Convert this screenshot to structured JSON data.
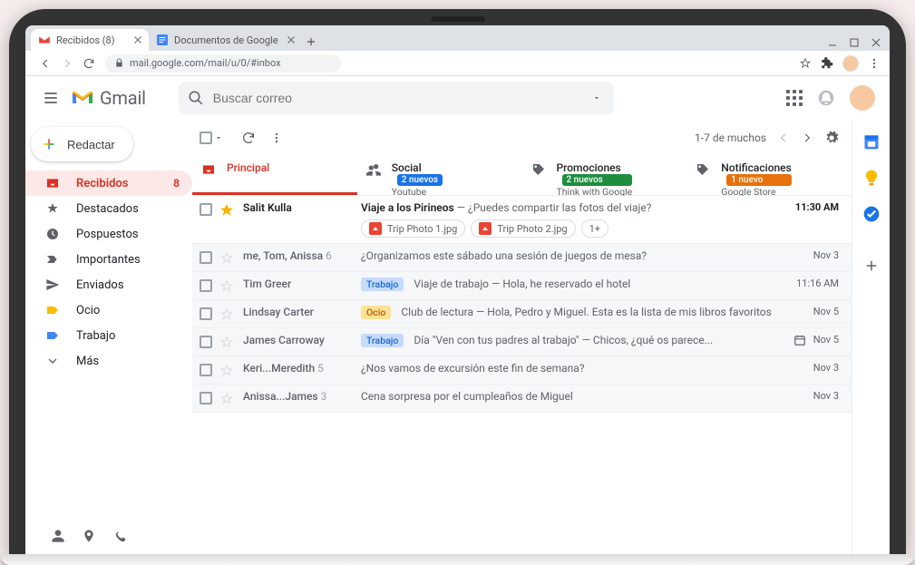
{
  "browser": {
    "tabs": [
      {
        "title": "Recibidos (8)",
        "active": true
      },
      {
        "title": "Documentos de Google",
        "active": false
      }
    ],
    "url": "mail.google.com/mail/u/0/#inbox"
  },
  "header": {
    "product": "Gmail",
    "search_placeholder": "Buscar correo"
  },
  "compose": "Redactar",
  "sidebar": {
    "items": [
      {
        "label": "Recibidos",
        "count": "8",
        "active": true,
        "icon": "inbox"
      },
      {
        "label": "Destacados",
        "icon": "star"
      },
      {
        "label": "Pospuestos",
        "icon": "clock"
      },
      {
        "label": "Importantes",
        "icon": "important"
      },
      {
        "label": "Enviados",
        "icon": "send"
      },
      {
        "label": "Ocio",
        "icon": "yellow"
      },
      {
        "label": "Trabajo",
        "icon": "blue"
      },
      {
        "label": "Más",
        "icon": "more"
      }
    ]
  },
  "toolbar": {
    "range": "1-7 de muchos"
  },
  "categories": [
    {
      "title": "Principal",
      "sub": "",
      "badge": "",
      "badge_cls": "",
      "active": true
    },
    {
      "title": "Social",
      "sub": "Youtube",
      "badge": "2 nuevos",
      "badge_cls": "blue"
    },
    {
      "title": "Promociones",
      "sub": "Think with Google",
      "badge": "2 nuevos",
      "badge_cls": "green"
    },
    {
      "title": "Notificaciones",
      "sub": "Google Store",
      "badge": "1 nuevo",
      "badge_cls": "orange"
    }
  ],
  "messages": [
    {
      "sender": "Salit Kulla",
      "subject": "Viaje a los Pirineos",
      "snippet": " — ¿Puedes compartir las fotos del viaje?",
      "date": "11:30 AM",
      "unread": true,
      "starred": true,
      "attachments": [
        "Trip Photo 1.jpg",
        "Trip Photo 2.jpg"
      ],
      "attachments_more": "1+"
    },
    {
      "sender": "me, Tom, Anissa",
      "sender_count": "6",
      "subject": "¿Organizamos este sábado una sesión de juegos de mesa?",
      "snippet": "",
      "date": "Nov 3",
      "unread": false
    },
    {
      "sender": "Tim Greer",
      "subject": "Viaje de trabajo",
      "snippet": " — Hola, he reservado el hotel",
      "date": "11:16 AM",
      "unread": false,
      "label": "Trabajo",
      "label_cls": "lbl-trabajo"
    },
    {
      "sender": "Lindsay Carter",
      "subject": "Club de lectura",
      "snippet": " — Hola, Pedro y Miguel. Esta es la lista de mis libros favoritos",
      "date": "Nov 5",
      "unread": false,
      "label": "Ocio",
      "label_cls": "lbl-ocio"
    },
    {
      "sender": "James Carroway",
      "subject": "Día \"Ven con tus padres al trabajo\"",
      "snippet": " — Chicos, ¿qué os parece...",
      "date": "Nov 5",
      "unread": false,
      "label": "Trabajo",
      "label_cls": "lbl-trabajo",
      "calendar": true
    },
    {
      "sender": "Keri...Meredith",
      "sender_count": "5",
      "subject": "¿Nos vamos de excursión este fin de semana?",
      "snippet": "",
      "date": "Nov 3",
      "unread": false
    },
    {
      "sender": "Anissa...James",
      "sender_count": "3",
      "subject": "Cena sorpresa por el cumpleaños de Miguel",
      "snippet": "",
      "date": "Nov 3",
      "unread": false
    }
  ]
}
